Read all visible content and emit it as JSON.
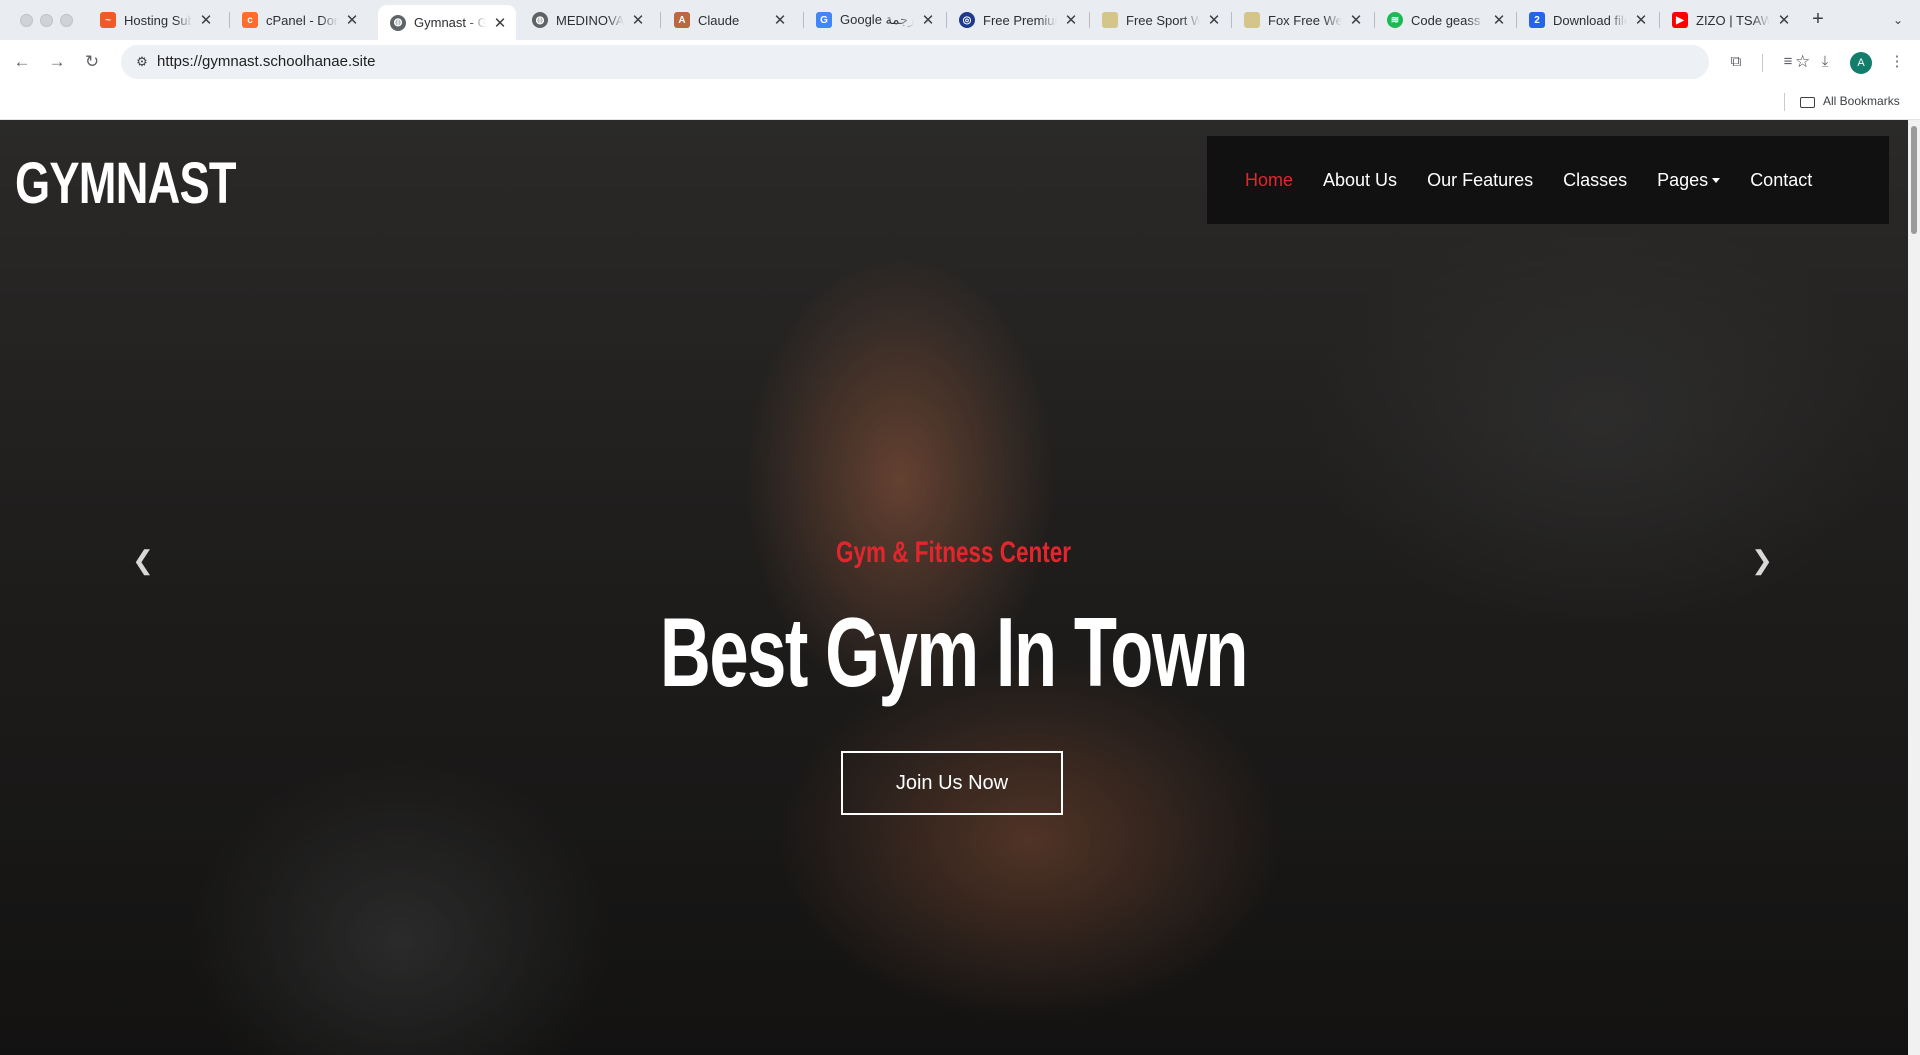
{
  "browser": {
    "tabs": [
      {
        "title": "Hosting Subscription",
        "favicon": "hosting-icon",
        "color": "#ef5a28"
      },
      {
        "title": "cPanel - Domains",
        "favicon": "cpanel-icon",
        "color": "#ff6c2c"
      },
      {
        "title": "Gymnast - Gym",
        "favicon": "globe-icon",
        "color": "#5f6368",
        "active": true
      },
      {
        "title": "MEDINOVA - Hospital",
        "favicon": "globe-icon",
        "color": "#5f6368"
      },
      {
        "title": "Claude",
        "favicon": "claude-icon",
        "color": "#b8693f"
      },
      {
        "title": "Google ترجمة",
        "favicon": "google-translate-icon",
        "color": "#4285f4"
      },
      {
        "title": "Free Premium",
        "favicon": "premium-icon",
        "color": "#1e3a8a"
      },
      {
        "title": "Free Sport Web",
        "favicon": "sport-icon",
        "color": "#d4c58a"
      },
      {
        "title": "Fox Free Web",
        "favicon": "fox-icon",
        "color": "#d4c58a"
      },
      {
        "title": "Code geass",
        "favicon": "spotify-icon",
        "color": "#1db954"
      },
      {
        "title": "Download file",
        "favicon": "download-site-icon",
        "color": "#2563eb"
      },
      {
        "title": "ZIZO | TSAW",
        "favicon": "youtube-icon",
        "color": "#ff0000"
      }
    ],
    "url": "https://gymnast.schoolhanae.site",
    "avatar_letter": "A",
    "bookmarks_label": "All Bookmarks"
  },
  "site": {
    "logo": "GYMNAST",
    "nav": [
      {
        "label": "Home",
        "active": true
      },
      {
        "label": "About Us"
      },
      {
        "label": "Our Features"
      },
      {
        "label": "Classes"
      },
      {
        "label": "Pages",
        "dropdown": true
      },
      {
        "label": "Contact"
      }
    ],
    "hero": {
      "subtitle": "Gym & Fitness Center",
      "headline": "Best Gym In Town",
      "cta": "Join Us Now"
    },
    "colors": {
      "accent": "#e3262d",
      "navbar_bg": "#111111"
    }
  }
}
